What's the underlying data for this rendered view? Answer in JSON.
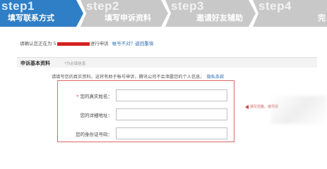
{
  "steps": [
    {
      "num": "step1",
      "label": "填写联系方式"
    },
    {
      "num": "step2",
      "label": "填写申诉资料"
    },
    {
      "num": "step3",
      "label": "邀请好友辅助"
    },
    {
      "num": "step4",
      "label": "完"
    }
  ],
  "confirm": {
    "prefix": "请确认您正在为 5",
    "suffix": "进行申诉",
    "links": "帐号不对？返回重填"
  },
  "section": {
    "title": "申诉基本资料",
    "required_note": "*为必填信息"
  },
  "intro": {
    "text": "请填写您的真实资料，这将有助于帐号申诉，腾讯公司不会泄露您的个人信息。",
    "privacy_link": "隐私条款"
  },
  "form": {
    "fields": [
      {
        "label": "您的真实姓名：",
        "required": "*",
        "value": ""
      },
      {
        "label": "您的详细地址：",
        "value": ""
      },
      {
        "label": "您的身份证号码：",
        "value": ""
      }
    ]
  },
  "side_hint": "填写完整，或号码",
  "colors": {
    "active_step": "#2f7fc6",
    "inactive_step": "#c8c8c8",
    "highlight_border": "#e06666",
    "link": "#2f6db3"
  }
}
